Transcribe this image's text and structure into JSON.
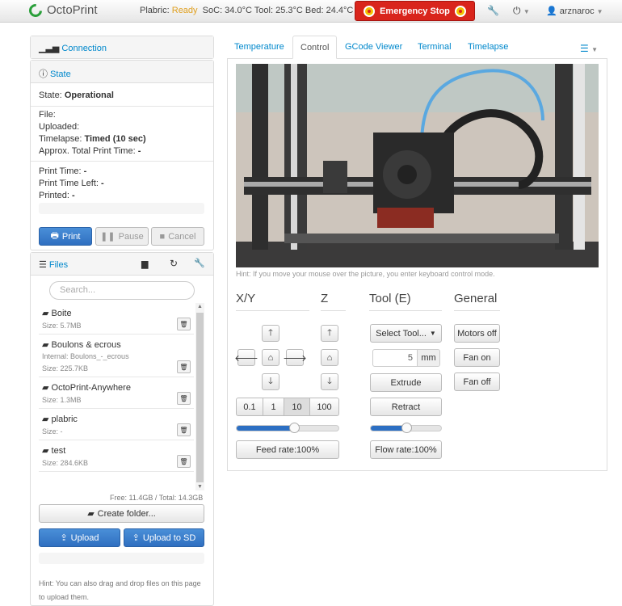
{
  "navbar": {
    "brand": "OctoPrint",
    "printer_name": "Plabric:",
    "printer_state": "Ready",
    "temps": "SoC: 34.0°C Tool: 25.3°C Bed: 24.4°C",
    "estop_label": "Emergency Stop",
    "user": "arznaroc"
  },
  "sidebar": {
    "connection_title": "Connection",
    "state_title": "State",
    "state": {
      "state_label": "State:",
      "state_value": "Operational",
      "file_label": "File:",
      "uploaded_label": "Uploaded:",
      "timelapse_label": "Timelapse:",
      "timelapse_value": "Timed (10 sec)",
      "total_label": "Approx. Total Print Time:",
      "total_value": "-",
      "print_time_label": "Print Time:",
      "print_time_value": "-",
      "time_left_label": "Print Time Left:",
      "time_left_value": "-",
      "printed_label": "Printed:",
      "printed_value": "-"
    },
    "buttons": {
      "print": "Print",
      "pause": "Pause",
      "cancel": "Cancel"
    },
    "files": {
      "title": "Files",
      "search_placeholder": "Search...",
      "items": [
        {
          "name": "Boite",
          "size": "Size: 5.7MB"
        },
        {
          "name": "Boulons & ecrous",
          "internal": "Internal: Boulons_-_ecrous",
          "size": "Size: 225.7KB"
        },
        {
          "name": "OctoPrint-Anywhere",
          "size": "Size: 1.3MB"
        },
        {
          "name": "plabric",
          "size": "Size: -"
        },
        {
          "name": "test",
          "size": "Size: 284.6KB"
        }
      ],
      "free_total": "Free: 11.4GB / Total: 14.3GB",
      "create_folder": "Create folder...",
      "upload": "Upload",
      "upload_sd": "Upload to SD",
      "hint_line1": "Hint: You can also drag and drop files on this page",
      "hint_line2": "to upload them."
    }
  },
  "tabs": [
    {
      "label": "Temperature"
    },
    {
      "label": "Control"
    },
    {
      "label": "GCode Viewer"
    },
    {
      "label": "Terminal"
    },
    {
      "label": "Timelapse"
    }
  ],
  "control": {
    "hint": "Hint: If you move your mouse over the picture, you enter keyboard control mode.",
    "xy_title": "X/Y",
    "z_title": "Z",
    "tool_title": "Tool (E)",
    "general_title": "General",
    "step_options": [
      "0.1",
      "1",
      "10",
      "100"
    ],
    "active_step": "10",
    "feed_rate_fraction": 0.56,
    "flow_rate_fraction": 0.5,
    "feed_rate_label": "Feed rate:100%",
    "flow_rate_label": "Flow rate:100%",
    "select_tool": "Select Tool...",
    "extrude_amount": "5",
    "extrude_unit": "mm",
    "extrude": "Extrude",
    "retract": "Retract",
    "motors_off": "Motors off",
    "fan_on": "Fan on",
    "fan_off": "Fan off"
  },
  "colors": {
    "accent": "#0088cc",
    "estop": "#d9251c",
    "ready": "#e0a020",
    "primary": "#2f6fc0"
  }
}
